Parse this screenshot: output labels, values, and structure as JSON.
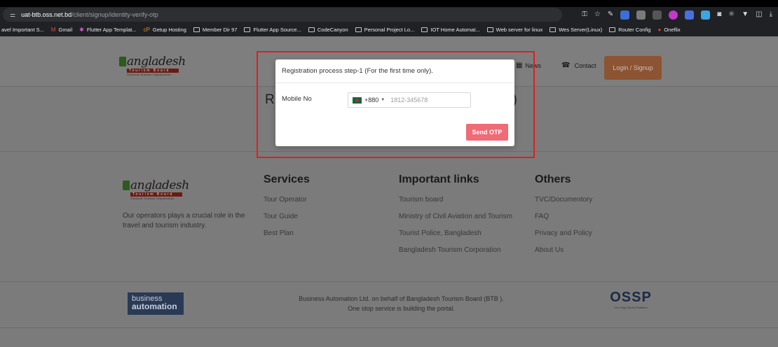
{
  "browser": {
    "tune_icon": "tune-icon",
    "url_host": "uat-btb.oss.net.bd",
    "url_path": "/client/signup/identity-verify-otp",
    "bookmarks": [
      {
        "label": "avel Important S...",
        "icon": "none"
      },
      {
        "label": "Gmail",
        "icon": "gmail-icon"
      },
      {
        "label": "Flutter App Templat...",
        "icon": "flutter-icon"
      },
      {
        "label": "Getup Hosting",
        "icon": "getup-icon"
      },
      {
        "label": "Member Dir 97",
        "icon": "folder-icon"
      },
      {
        "label": "Flutter App Source...",
        "icon": "folder-icon"
      },
      {
        "label": "CodeCanyon",
        "icon": "folder-icon"
      },
      {
        "label": "Personal Project Lo...",
        "icon": "folder-icon"
      },
      {
        "label": "IOT Home Automat...",
        "icon": "folder-icon"
      },
      {
        "label": "Web server for linux",
        "icon": "folder-icon"
      },
      {
        "label": "Wes Server(Linux)",
        "icon": "folder-icon"
      },
      {
        "label": "Router Config",
        "icon": "folder-icon"
      },
      {
        "label": "Oneflix",
        "icon": "oneflix-icon"
      }
    ]
  },
  "site": {
    "logo_name": "angladesh",
    "logo_board": "Tourism Board",
    "logo_org": "National Tourism Organization",
    "nav": {
      "news": "News",
      "contact": "Contact",
      "login": "Login / Signup"
    },
    "behind_title_left": "R",
    "behind_title_right": "y)",
    "footer": {
      "about": "Our operators plays a crucial role in the travel and tourism industry.",
      "services": {
        "title": "Services",
        "links": [
          "Tour Operator",
          "Tour Guide",
          "Best Plan"
        ]
      },
      "important": {
        "title": "Important links",
        "links": [
          "Tourism board",
          "Ministry of Civil Aviation and Tourism",
          "Tourist Police, Bangladesh",
          "Bangladesh Tourism Corporation"
        ]
      },
      "others": {
        "title": "Others",
        "links": [
          "TVC/Documentory",
          "FAQ",
          "Privacy and Policy",
          "About Us"
        ]
      },
      "ba_line1": "business",
      "ba_line2": "automation",
      "credit_line1": "Business Automation Ltd. on behalf of Bangladesh Tourism Board (BTB ).",
      "credit_line2": "One stop service is building the portal.",
      "ossp": "OSSP",
      "ossp_sub": "One Stop Service Platform"
    }
  },
  "modal": {
    "title": "Registration process step-1 (For the first time only).",
    "mobile_label": "Mobile No",
    "country_code": "+880",
    "phone_placeholder": "1812-345678",
    "send_button": "Send OTP"
  },
  "colors": {
    "highlight": "#e01f1f",
    "send_button": "#ef6b76",
    "login_button": "#8c5433"
  }
}
